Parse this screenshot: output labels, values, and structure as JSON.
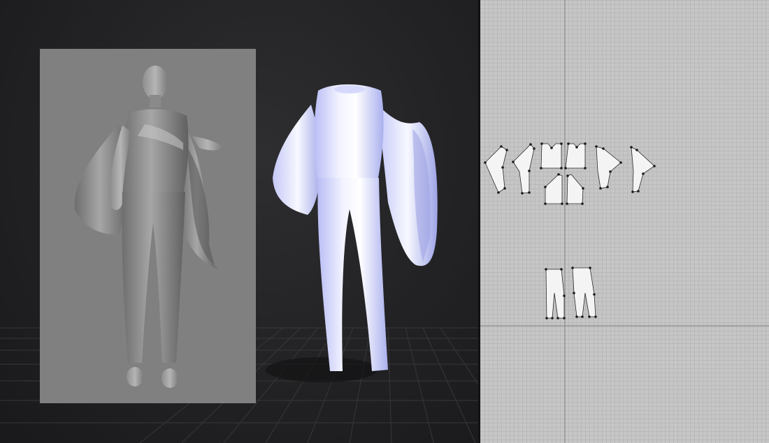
{
  "app": {
    "views": [
      "3d-viewport",
      "2d-pattern-editor"
    ]
  },
  "viewport3d": {
    "background": "#222224",
    "floor_grid": true,
    "reference_image": {
      "subject": "sculpted-avatar-in-garment",
      "tone": "#808080"
    },
    "garment": {
      "type": "jumpsuit-with-bell-sleeves",
      "color": "#eef0ff"
    }
  },
  "pattern_editor": {
    "background": "#c6c6c6",
    "grid": true,
    "axis_color": "#9a9a9a",
    "piece_fill": "#f4f4f4",
    "piece_count": 10,
    "pieces": [
      "front-bodice-left",
      "sleeve-left",
      "front-bodice",
      "back-bodice",
      "sleeve-right",
      "sleeve-far-right",
      "bodice-lower-left",
      "bodice-lower-right",
      "trouser-front",
      "trouser-back"
    ]
  }
}
